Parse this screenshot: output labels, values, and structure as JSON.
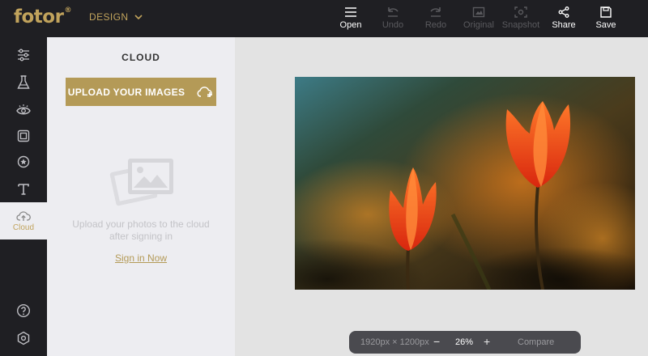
{
  "header": {
    "logo": "fotor",
    "logo_mark": "®",
    "menu_label": "DESIGN",
    "tools": [
      {
        "label": "Open",
        "icon": "hamburger-icon",
        "enabled": true
      },
      {
        "label": "Undo",
        "icon": "undo-icon",
        "enabled": false
      },
      {
        "label": "Redo",
        "icon": "redo-icon",
        "enabled": false
      },
      {
        "label": "Original",
        "icon": "image-icon",
        "enabled": false
      },
      {
        "label": "Snapshot",
        "icon": "snapshot-icon",
        "enabled": false
      },
      {
        "label": "Share",
        "icon": "share-icon",
        "enabled": true
      },
      {
        "label": "Save",
        "icon": "save-icon",
        "enabled": true
      }
    ]
  },
  "rail": {
    "items": [
      {
        "icon": "sliders-icon"
      },
      {
        "icon": "flask-icon"
      },
      {
        "icon": "eye-icon"
      },
      {
        "icon": "frame-icon"
      },
      {
        "icon": "star-badge-icon"
      },
      {
        "icon": "text-icon"
      },
      {
        "icon": "cloud-icon",
        "label": "Cloud",
        "active": true
      },
      {
        "icon": "help-icon"
      },
      {
        "icon": "settings-icon"
      }
    ]
  },
  "panel": {
    "title": "CLOUD",
    "upload_label": "UPLOAD YOUR IMAGES",
    "empty_text": "Upload your photos to the cloud after signing in",
    "signin_label": "Sign in Now"
  },
  "zoom": {
    "dimensions": "1920px × 1200px",
    "minus": "−",
    "value": "26%",
    "plus": "+",
    "compare_label": "Compare"
  },
  "colors": {
    "accent": "#b49a57",
    "topbar": "#1f1f23",
    "panel": "#ededf1"
  }
}
